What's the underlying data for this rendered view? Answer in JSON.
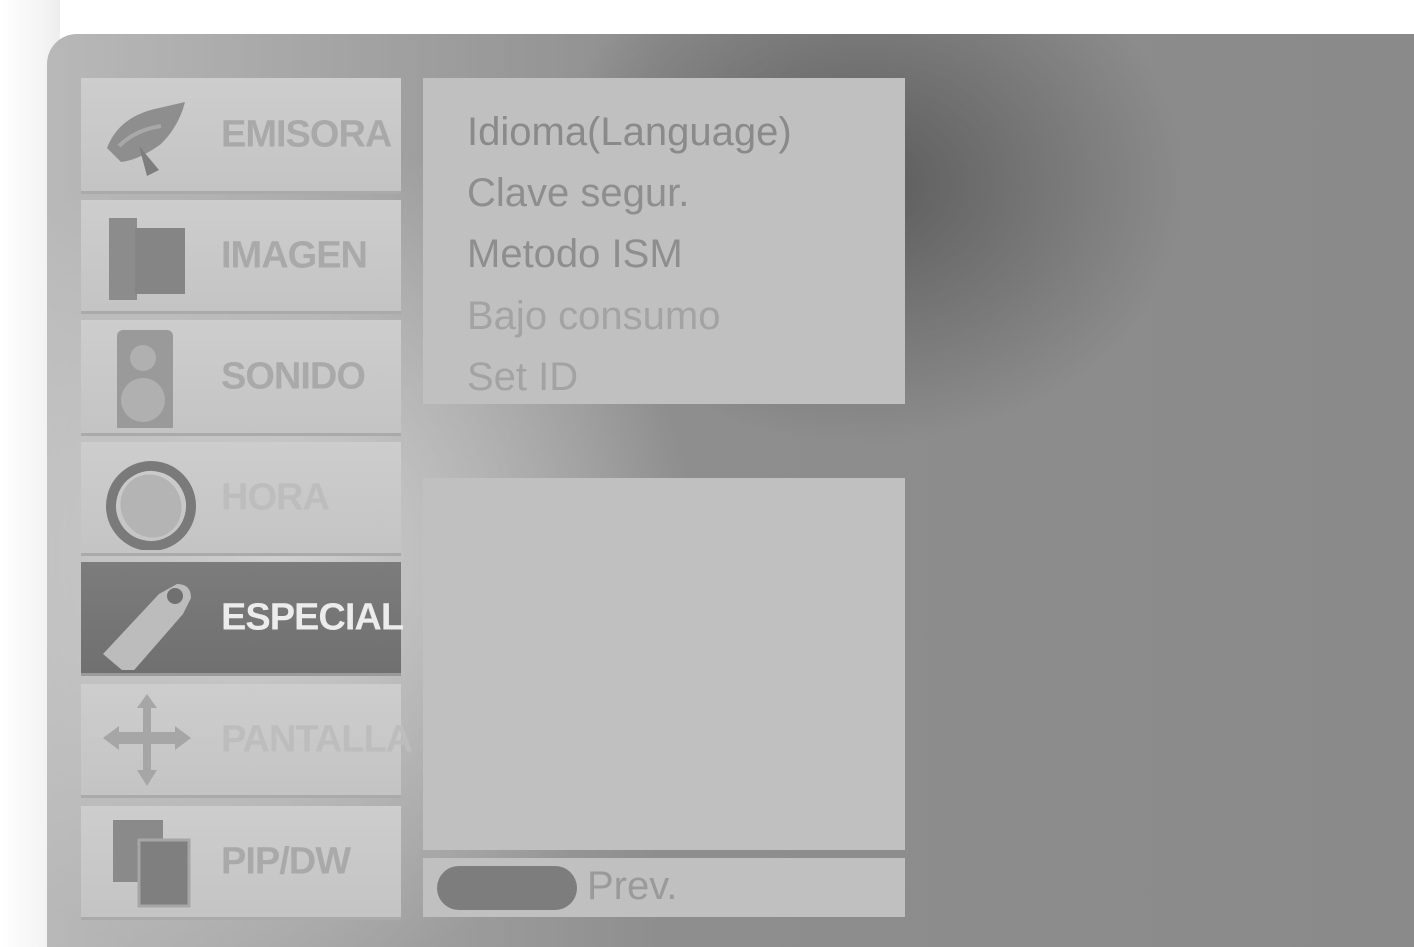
{
  "sidebar": {
    "items": [
      {
        "label": "EMISORA",
        "icon": "satellite-dish-icon"
      },
      {
        "label": "IMAGEN",
        "icon": "picture-icon"
      },
      {
        "label": "SONIDO",
        "icon": "speaker-icon"
      },
      {
        "label": "HORA",
        "icon": "clock-icon"
      },
      {
        "label": "ESPECIAL",
        "icon": "tag-icon",
        "selected": true
      },
      {
        "label": "PANTALLA",
        "icon": "move-arrows-icon"
      },
      {
        "label": "PIP/DW",
        "icon": "pip-windows-icon"
      }
    ]
  },
  "submenu": {
    "items": [
      {
        "label": "Idioma(Language)"
      },
      {
        "label": "Clave segur."
      },
      {
        "label": "Metodo ISM"
      },
      {
        "label": "Bajo consumo"
      },
      {
        "label": "Set ID"
      }
    ]
  },
  "footer": {
    "prev_label": "Prev."
  }
}
